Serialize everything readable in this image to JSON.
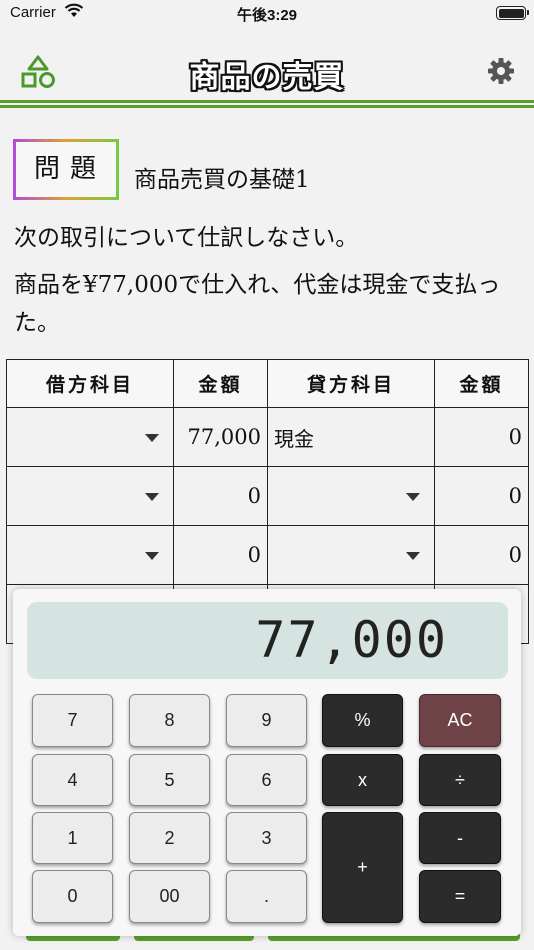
{
  "status_bar": {
    "carrier": "Carrier",
    "time": "午後3:29"
  },
  "nav": {
    "title": "商品の売買"
  },
  "problem": {
    "badge": "問題",
    "title": "商品売買の基礎1",
    "instruction": "次の取引について仕訳しなさい。",
    "text": "商品を¥77,000で仕入れ、代金は現金で支払った。"
  },
  "journal": {
    "headers": [
      "借方科目",
      "金額",
      "貸方科目",
      "金額"
    ],
    "rows": [
      {
        "debit_account": "",
        "debit_amount": "77,000",
        "credit_account": "現金",
        "credit_amount": "0"
      },
      {
        "debit_account": "",
        "debit_amount": "0",
        "credit_account": "",
        "credit_amount": "0"
      },
      {
        "debit_account": "",
        "debit_amount": "0",
        "credit_account": "",
        "credit_amount": "0"
      }
    ]
  },
  "calculator": {
    "display": "77,000",
    "keys": {
      "k7": "7",
      "k8": "8",
      "k9": "9",
      "pct": "%",
      "ac": "AC",
      "k4": "4",
      "k5": "5",
      "k6": "6",
      "mul": "x",
      "div": "÷",
      "k1": "1",
      "k2": "2",
      "k3": "3",
      "plus": "+",
      "minus": "-",
      "k0": "0",
      "k00": "00",
      "dot": ".",
      "eq": "="
    }
  }
}
